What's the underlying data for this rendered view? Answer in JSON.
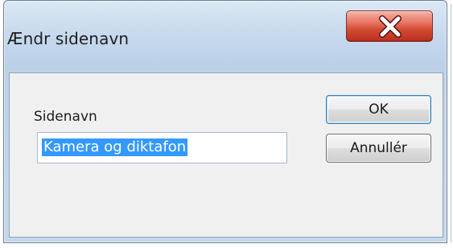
{
  "window": {
    "title": "Ændr sidenavn"
  },
  "dialog": {
    "field_label": "Sidenavn",
    "input_value": "Kamera og diktafon",
    "ok_label": "OK",
    "cancel_label": "Annullér"
  },
  "icons": {
    "close": "close-icon"
  },
  "colors": {
    "close_button": "#d24a33",
    "selection": "#3399ff",
    "dialog_background": "#f0f0f0"
  }
}
